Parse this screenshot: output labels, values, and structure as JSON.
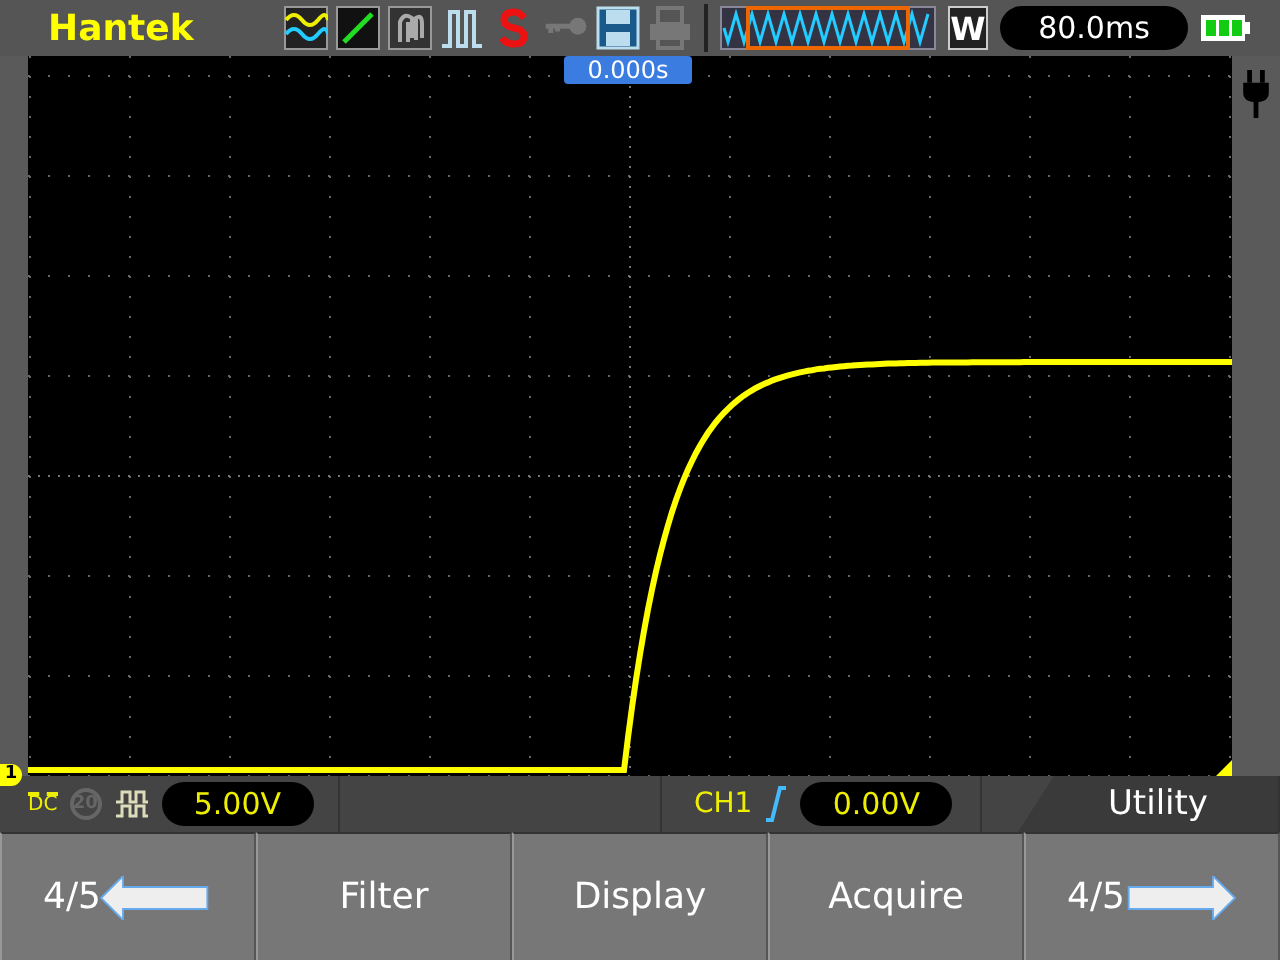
{
  "top_bar": {
    "brand": "Hantek",
    "window_mode": "W",
    "timebase": "80.0ms"
  },
  "screen": {
    "time_offset": "0.000s",
    "channel_marker": "1"
  },
  "info_bar": {
    "coupling": "DC",
    "bandwidth_limit": {
      "label": "20",
      "on": false
    },
    "volts_div": "5.00V",
    "trigger_source": "CH1",
    "trigger_level": "0.00V",
    "menu_title": "Utility"
  },
  "softkeys": [
    {
      "label": "4/5",
      "kind": "prev"
    },
    {
      "label": "Filter",
      "kind": "plain"
    },
    {
      "label": "Display",
      "kind": "plain"
    },
    {
      "label": "Acquire",
      "kind": "plain"
    },
    {
      "label": "4/5",
      "kind": "next"
    }
  ]
}
